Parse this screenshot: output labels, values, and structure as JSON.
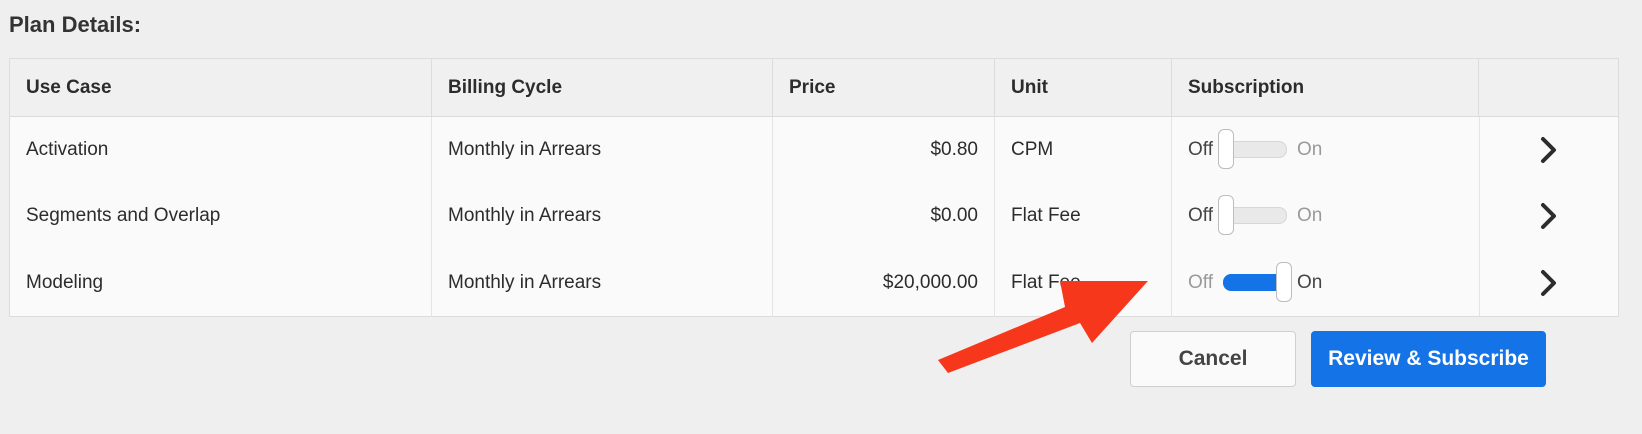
{
  "plan": {
    "title": "Plan Details:",
    "headers": [
      "Use Case",
      "Billing Cycle",
      "Price",
      "Unit",
      "Subscription",
      ""
    ],
    "rows": [
      {
        "use_case": "Activation",
        "billing_cycle": "Monthly in Arrears",
        "price": "$0.80",
        "unit": "CPM",
        "subscription": "off"
      },
      {
        "use_case": "Segments and Overlap",
        "billing_cycle": "Monthly in Arrears",
        "price": "$0.00",
        "unit": "Flat Fee",
        "subscription": "off"
      },
      {
        "use_case": "Modeling",
        "billing_cycle": "Monthly in Arrears",
        "price": "$20,000.00",
        "unit": "Flat Fee",
        "subscription": "on"
      }
    ],
    "toggle_off_label": "Off",
    "toggle_on_label": "On",
    "row_action_icon": "chevron-right-icon"
  },
  "actions": {
    "cancel_label": "Cancel",
    "review_label": "Review & Subscribe"
  },
  "colors": {
    "accent": "#1473e6",
    "annotation_arrow": "#f7371c"
  }
}
